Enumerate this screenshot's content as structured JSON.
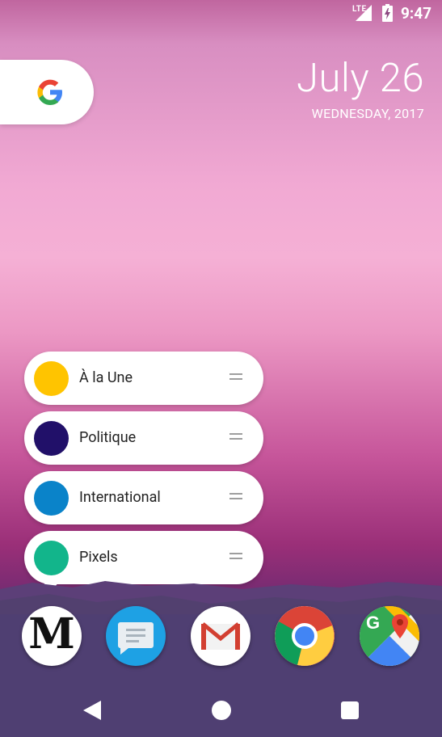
{
  "status_bar": {
    "network": "LTE",
    "time": "9:47"
  },
  "date_widget": {
    "date": "July 26",
    "weekday_date": "WEDNESDAY, 2017"
  },
  "shortcuts": [
    {
      "label": "À la Une",
      "color": "#ffc400"
    },
    {
      "label": "Politique",
      "color": "#211069"
    },
    {
      "label": "International",
      "color": "#0a83c9"
    },
    {
      "label": "Pixels",
      "color": "#12b58b"
    }
  ],
  "dock": {
    "apps": [
      "le-monde",
      "messages",
      "gmail",
      "chrome",
      "maps"
    ],
    "lemonde_glyph": "M"
  },
  "colors": {
    "accent_yellow": "#ffc400",
    "dock_bg": "#4f3f72"
  }
}
